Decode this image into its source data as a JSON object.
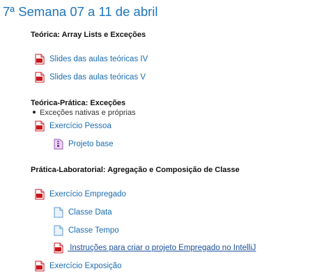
{
  "week_title": "7ª Semana 07 a 11 de abril",
  "sections": {
    "teorica": {
      "heading": "Teórica: Array Lists e Exceções",
      "items": [
        {
          "label": "Slides das aulas teóricas IV",
          "icon": "pdf-icon"
        },
        {
          "label": "Slides das aulas teóricas V",
          "icon": "pdf-icon"
        }
      ]
    },
    "teorica_pratica": {
      "heading": "Teórica-Prática: Exceções",
      "bullet": "Exceções nativas e próprias",
      "items": [
        {
          "label": "Exercício Pessoa",
          "icon": "pdf-icon"
        },
        {
          "label": "Projeto base",
          "icon": "archive-icon"
        }
      ]
    },
    "pratica_lab": {
      "heading": "Prática-Laboratorial: Agregação e Composição de Classe",
      "items": [
        {
          "label": "Exercício Empregado",
          "icon": "pdf-icon"
        },
        {
          "label": "Classe Data",
          "icon": "document-icon"
        },
        {
          "label": "Classe Tempo",
          "icon": "document-icon"
        },
        {
          "label": " Instruções para criar o projeto Empregado no IntelliJ",
          "icon": "pdf-icon"
        },
        {
          "label": "Exercício Exposição",
          "icon": "pdf-icon"
        }
      ]
    }
  },
  "colors": {
    "title": "#1e74b9",
    "link": "#1a6cb0",
    "pdf_red": "#c8161d",
    "archive_purple": "#9b59b6",
    "doc_blue": "#5b9bd5"
  }
}
